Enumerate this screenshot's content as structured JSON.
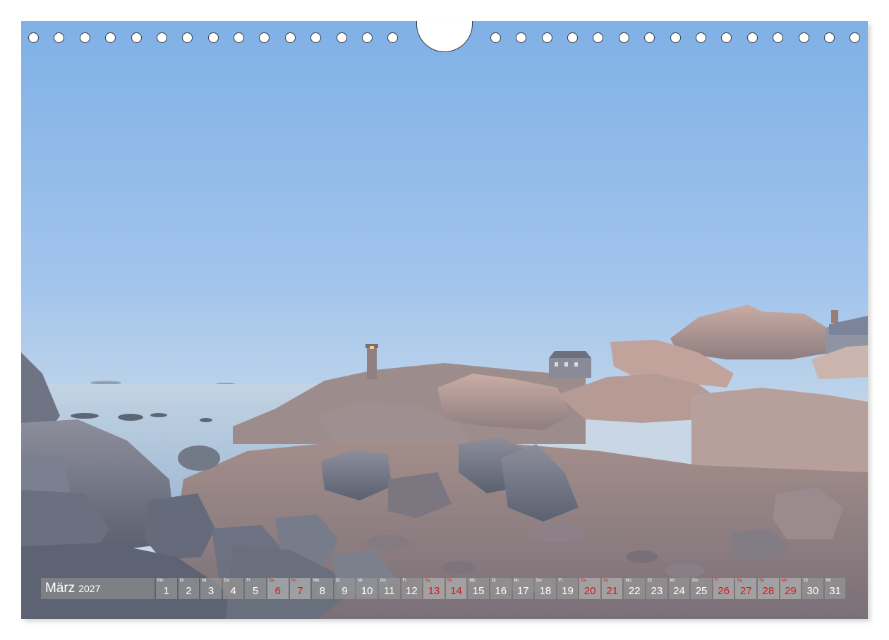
{
  "calendar": {
    "month": "März",
    "year": "2027",
    "colors": {
      "weekday_text": "#ffffff",
      "weekend_text": "#d71a1a",
      "cell_bg": "#969696"
    },
    "days": [
      {
        "weekday": "Mo",
        "day": "1",
        "weekend": false
      },
      {
        "weekday": "Di",
        "day": "2",
        "weekend": false
      },
      {
        "weekday": "Mi",
        "day": "3",
        "weekend": false
      },
      {
        "weekday": "Do",
        "day": "4",
        "weekend": false
      },
      {
        "weekday": "Fr",
        "day": "5",
        "weekend": false
      },
      {
        "weekday": "Sa",
        "day": "6",
        "weekend": true
      },
      {
        "weekday": "So",
        "day": "7",
        "weekend": true
      },
      {
        "weekday": "Mo",
        "day": "8",
        "weekend": false
      },
      {
        "weekday": "Di",
        "day": "9",
        "weekend": false
      },
      {
        "weekday": "Mi",
        "day": "10",
        "weekend": false
      },
      {
        "weekday": "Do",
        "day": "11",
        "weekend": false
      },
      {
        "weekday": "Fr",
        "day": "12",
        "weekend": false
      },
      {
        "weekday": "Sa",
        "day": "13",
        "weekend": true
      },
      {
        "weekday": "So",
        "day": "14",
        "weekend": true
      },
      {
        "weekday": "Mo",
        "day": "15",
        "weekend": false
      },
      {
        "weekday": "Di",
        "day": "16",
        "weekend": false
      },
      {
        "weekday": "Mi",
        "day": "17",
        "weekend": false
      },
      {
        "weekday": "Do",
        "day": "18",
        "weekend": false
      },
      {
        "weekday": "Fr",
        "day": "19",
        "weekend": false
      },
      {
        "weekday": "Sa",
        "day": "20",
        "weekend": true
      },
      {
        "weekday": "So",
        "day": "21",
        "weekend": true
      },
      {
        "weekday": "Mo",
        "day": "22",
        "weekend": false
      },
      {
        "weekday": "Di",
        "day": "23",
        "weekend": false
      },
      {
        "weekday": "Mi",
        "day": "24",
        "weekend": false
      },
      {
        "weekday": "Do",
        "day": "25",
        "weekend": false
      },
      {
        "weekday": "Fr",
        "day": "26",
        "weekend": true
      },
      {
        "weekday": "Sa",
        "day": "27",
        "weekend": true
      },
      {
        "weekday": "So",
        "day": "28",
        "weekend": true
      },
      {
        "weekday": "Mo",
        "day": "29",
        "weekend": true
      },
      {
        "weekday": "Di",
        "day": "30",
        "weekend": false
      },
      {
        "weekday": "Mi",
        "day": "31",
        "weekend": false
      }
    ]
  },
  "photo": {
    "subject": "rocky coastline with lighthouse at dusk",
    "sky_colors": [
      "#7fb0e6",
      "#a8c8ec",
      "#c9d6e6"
    ],
    "sea_color": "#b9cde0",
    "rock_colors": [
      "#b9a9a3",
      "#8d8a93",
      "#6f7482"
    ]
  },
  "binding": {
    "hole_count_left": 15,
    "hole_count_right": 15
  }
}
